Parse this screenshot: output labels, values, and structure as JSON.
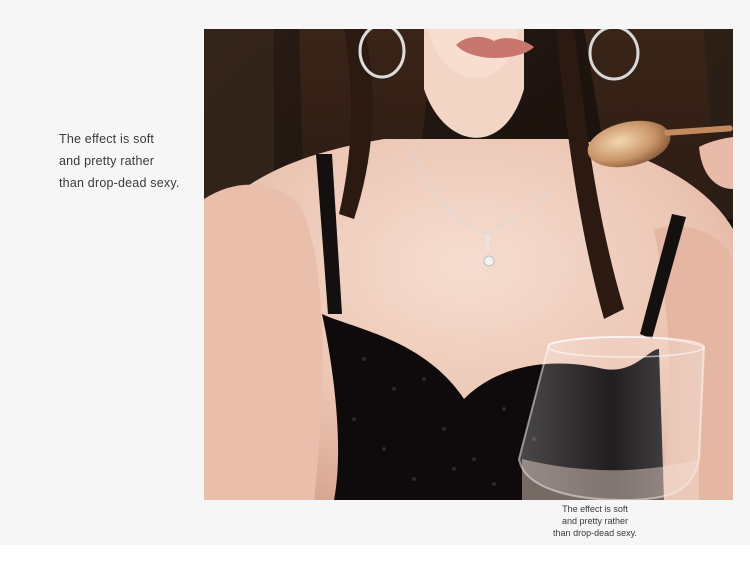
{
  "description_copy": {
    "lines": [
      "The effect is soft",
      "and pretty rather",
      "than drop-dead sexy."
    ]
  },
  "photo": {
    "icon": "product-photo-necklace-model"
  },
  "caption": {
    "lines": [
      "The effect is soft",
      "and pretty rather",
      "than drop-dead sexy."
    ]
  }
}
